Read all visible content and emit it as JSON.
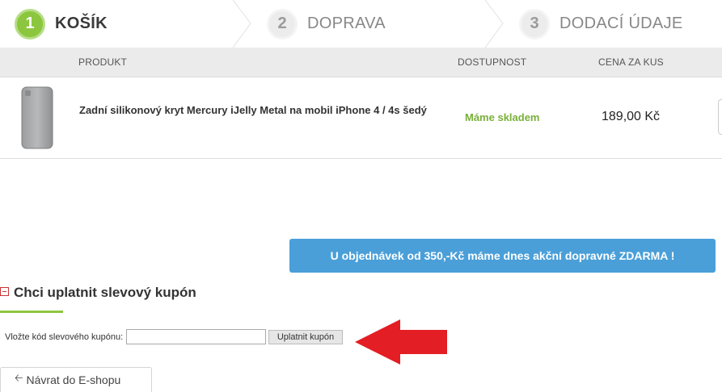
{
  "steps": [
    {
      "number": "1",
      "label": "KOŠÍK",
      "state": "active"
    },
    {
      "number": "2",
      "label": "DOPRAVA",
      "state": "inactive"
    },
    {
      "number": "3",
      "label": "DODACÍ ÚDAJE",
      "state": "inactive"
    }
  ],
  "table": {
    "headers": {
      "product": "PRODUKT",
      "availability": "DOSTUPNOST",
      "unit_price": "CENA ZA KUS"
    },
    "rows": [
      {
        "name": "Zadní silikonový kryt Mercury iJelly Metal na mobil iPhone 4 / 4s šedý",
        "availability": "Máme skladem",
        "price": "189,00 Kč"
      }
    ]
  },
  "promo": {
    "text": "U objednávek od 350,-Kč máme dnes akční dopravné ZDARMA !"
  },
  "coupon": {
    "title": "Chci uplatnit slevový kupón",
    "field_label": "Vložte kód slevového kupónu:",
    "value": "",
    "button_label": "Uplatnit kupón"
  },
  "back": {
    "label": "Návrat do E-shopu",
    "icon": "arrow-left-icon"
  },
  "colors": {
    "accent_green": "#8cc63f",
    "stock_green": "#7ab03a",
    "promo_blue": "#4a9fd8",
    "arrow_red": "#e31e24"
  }
}
